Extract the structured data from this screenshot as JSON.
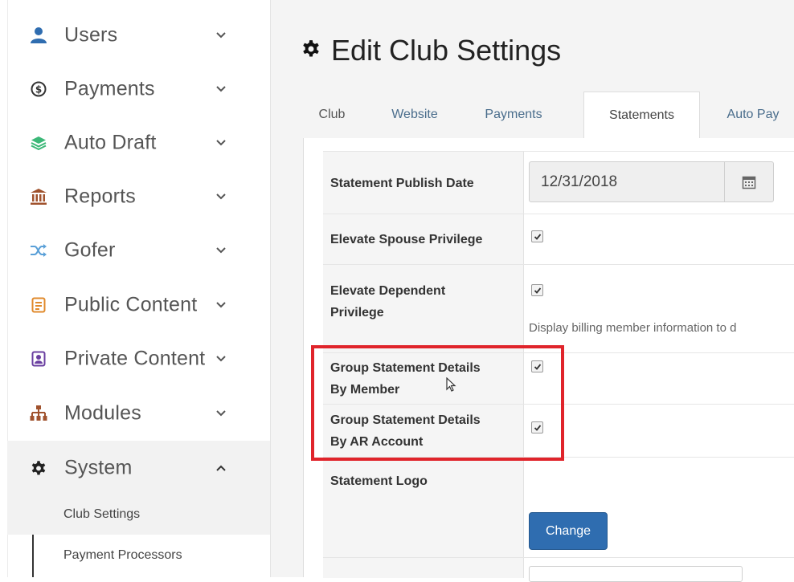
{
  "sidebar": {
    "items": [
      {
        "label": "Users",
        "icon": "user-icon",
        "color": "#2f6db0",
        "expanded": false
      },
      {
        "label": "Payments",
        "icon": "dollar-circle-icon",
        "color": "#333333",
        "expanded": false
      },
      {
        "label": "Auto Draft",
        "icon": "layers-icon",
        "color": "#3cb878",
        "expanded": false
      },
      {
        "label": "Reports",
        "icon": "bank-icon",
        "color": "#a0522d",
        "expanded": false
      },
      {
        "label": "Gofer",
        "icon": "shuffle-icon",
        "color": "#5aa0d8",
        "expanded": false
      },
      {
        "label": "Public Content",
        "icon": "document-icon",
        "color": "#e08a2c",
        "expanded": false
      },
      {
        "label": "Private Content",
        "icon": "badge-icon",
        "color": "#6a3fa0",
        "expanded": false
      },
      {
        "label": "Modules",
        "icon": "sitemap-icon",
        "color": "#a0522d",
        "expanded": false
      },
      {
        "label": "System",
        "icon": "gear-icon",
        "color": "#222222",
        "expanded": true
      }
    ],
    "subitems": [
      {
        "label": "Club Settings",
        "active": true
      },
      {
        "label": "Payment Processors",
        "active": false
      }
    ]
  },
  "main": {
    "title": "Edit Club Settings",
    "tabs": [
      {
        "label": "Club",
        "active": false
      },
      {
        "label": "Website",
        "active": false
      },
      {
        "label": "Payments",
        "active": false
      },
      {
        "label": "Statements",
        "active": true
      },
      {
        "label": "Auto Pay",
        "active": false
      }
    ],
    "form": {
      "publish_date_label": "Statement Publish Date",
      "publish_date_value": "12/31/2018",
      "spouse_label": "Elevate Spouse Privilege",
      "spouse_checked": true,
      "dependent_label_line1": "Elevate Dependent",
      "dependent_label_line2": "Privilege",
      "dependent_checked": true,
      "dependent_help": "Display billing member information to d",
      "group_member_label_line1": "Group Statement Details",
      "group_member_label_line2": "By Member",
      "group_member_checked": true,
      "group_ar_label_line1": "Group Statement Details",
      "group_ar_label_line2": "By AR Account",
      "group_ar_checked": true,
      "logo_label": "Statement Logo",
      "change_button": "Change"
    }
  },
  "colors": {
    "accent": "#2f6db0",
    "highlight": "#e0242b",
    "tab_link": "#4a6d8c"
  }
}
